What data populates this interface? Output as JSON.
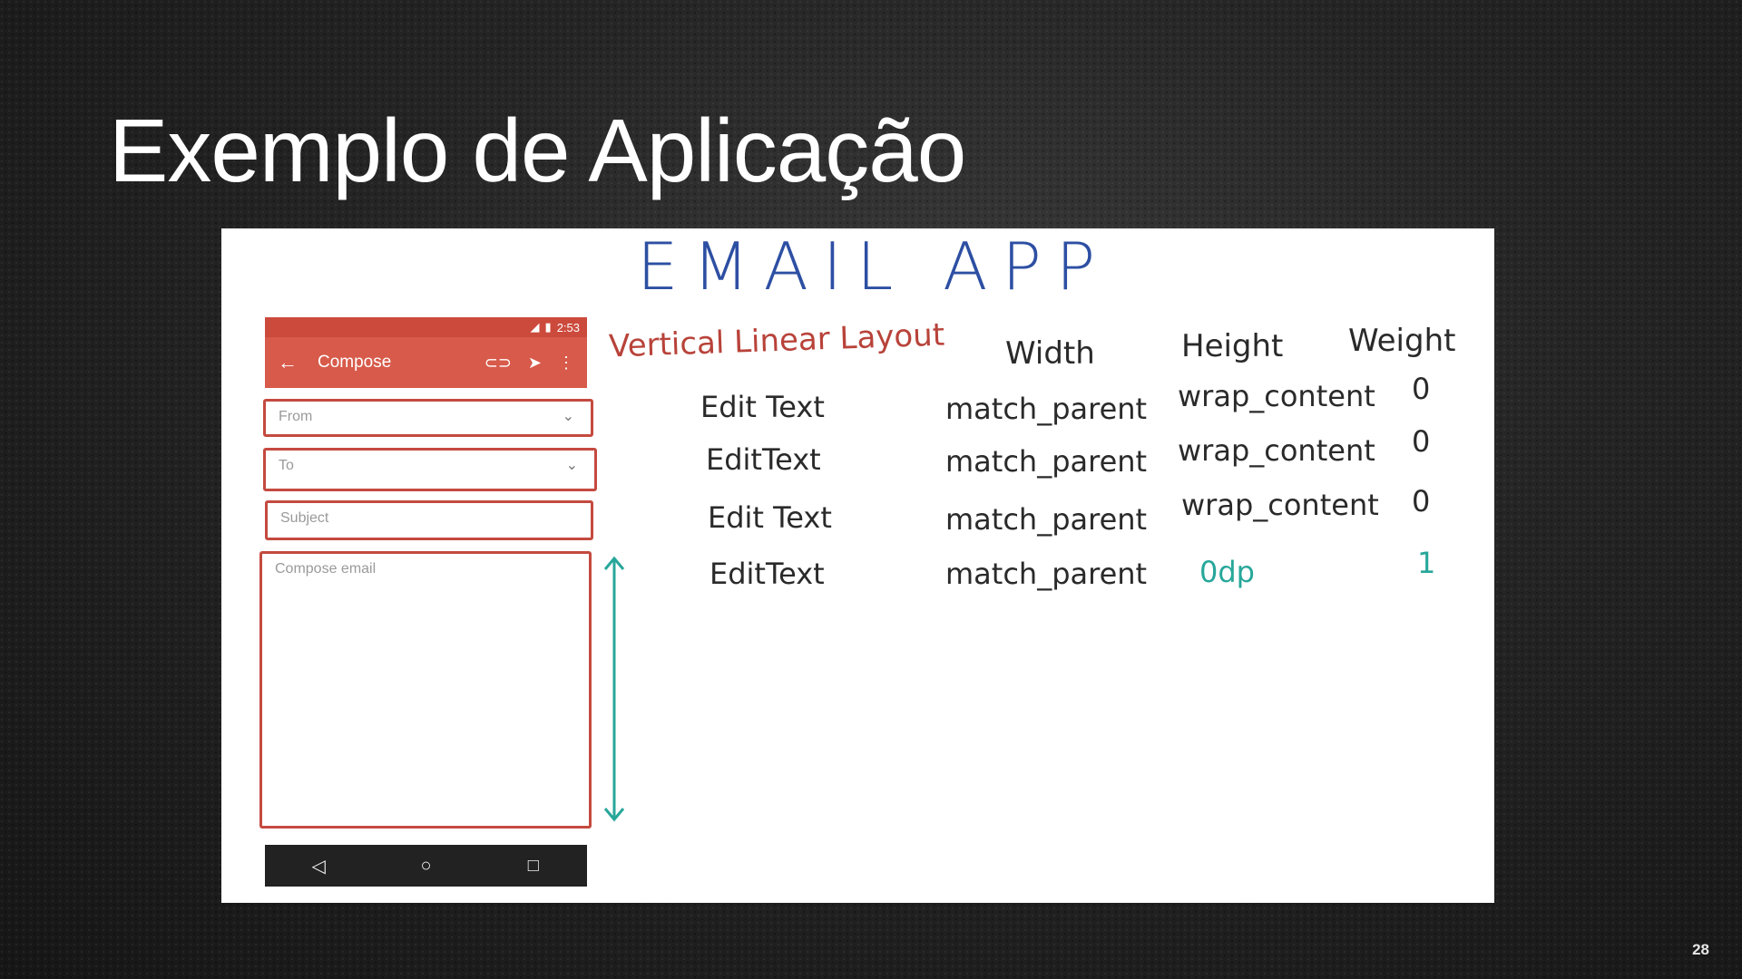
{
  "slide": {
    "title": "Exemplo de Aplicação",
    "page_number": "28"
  },
  "board": {
    "title": "EMAIL APP",
    "layout_label": "Vertical Linear Layout",
    "headers": {
      "width": "Width",
      "height": "Height",
      "weight": "Weight"
    },
    "rows": [
      {
        "view": "Edit Text",
        "width": "match_parent",
        "height": "wrap_content",
        "weight": "0"
      },
      {
        "view": "EditText",
        "width": "match_parent",
        "height": "wrap_content",
        "weight": "0"
      },
      {
        "view": "Edit Text",
        "width": "match_parent",
        "height": "wrap_content",
        "weight": "0"
      },
      {
        "view": "EditText",
        "width": "match_parent",
        "height": "0dp",
        "weight": "1"
      }
    ],
    "colors": {
      "title": "#2d4fa3",
      "label": "#b8433a",
      "highlight": "#27a79a",
      "phone_frame": "#c44a3f"
    }
  },
  "phone": {
    "status_time": "2:53",
    "toolbar_title": "Compose",
    "fields": {
      "from": "From",
      "to": "To",
      "subject": "Subject",
      "body": "Compose email"
    },
    "icons": [
      "back-arrow-icon",
      "attach-icon",
      "send-icon",
      "more-vert-icon",
      "chevron-down-icon",
      "nav-back-icon",
      "nav-home-icon",
      "nav-recents-icon"
    ]
  }
}
